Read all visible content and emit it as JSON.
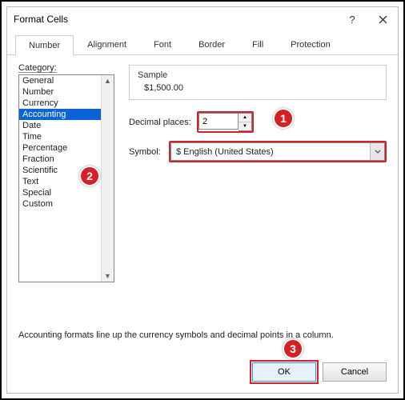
{
  "titlebar": {
    "title": "Format Cells"
  },
  "tabs": {
    "number": "Number",
    "alignment": "Alignment",
    "font": "Font",
    "border": "Border",
    "fill": "Fill",
    "protection": "Protection"
  },
  "category": {
    "label": "Category:",
    "items": [
      "General",
      "Number",
      "Currency",
      "Accounting",
      "Date",
      "Time",
      "Percentage",
      "Fraction",
      "Scientific",
      "Text",
      "Special",
      "Custom"
    ],
    "selected": "Accounting"
  },
  "sample": {
    "label": "Sample",
    "value": "$1,500.00"
  },
  "decimal": {
    "label": "Decimal places:",
    "value": "2"
  },
  "symbol": {
    "label": "Symbol:",
    "value": "$ English (United States)"
  },
  "hint": "Accounting formats line up the currency symbols and decimal points in a column.",
  "buttons": {
    "ok": "OK",
    "cancel": "Cancel"
  },
  "annotations": {
    "a1": "1",
    "a2": "2",
    "a3": "3"
  }
}
